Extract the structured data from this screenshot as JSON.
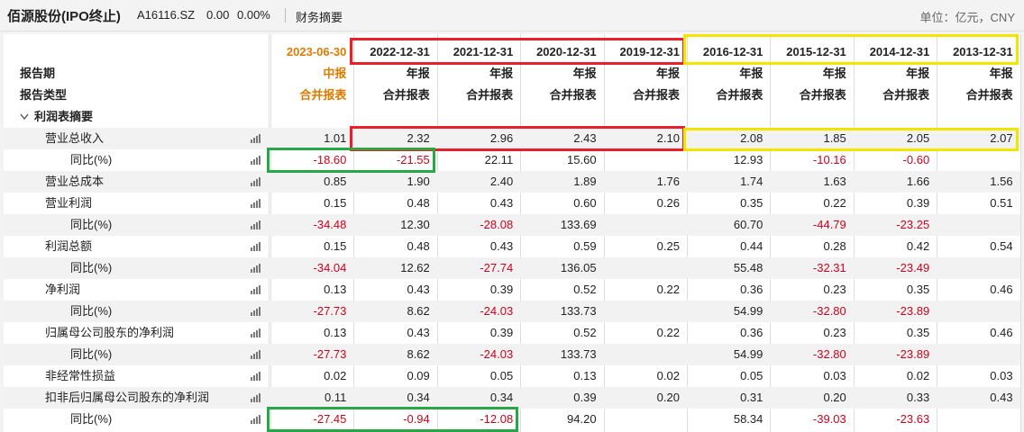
{
  "header": {
    "name": "佰源股份(IPO终止)",
    "code": "A16116.SZ",
    "price": "0.00",
    "change_pct": "0.00%",
    "section": "财务摘要",
    "unit": "单位：亿元，CNY"
  },
  "columns": [
    {
      "date": "2023-06-30",
      "period": "中报",
      "type": "合并报表"
    },
    {
      "date": "2022-12-31",
      "period": "年报",
      "type": "合并报表"
    },
    {
      "date": "2021-12-31",
      "period": "年报",
      "type": "合并报表"
    },
    {
      "date": "2020-12-31",
      "period": "年报",
      "type": "合并报表"
    },
    {
      "date": "2019-12-31",
      "period": "年报",
      "type": "合并报表"
    },
    {
      "date": "2016-12-31",
      "period": "年报",
      "type": "合并报表"
    },
    {
      "date": "2015-12-31",
      "period": "年报",
      "type": "合并报表"
    },
    {
      "date": "2014-12-31",
      "period": "年报",
      "type": "合并报表"
    },
    {
      "date": "2013-12-31",
      "period": "年报",
      "type": "合并报表"
    }
  ],
  "row_labels": {
    "period": "报告期",
    "type": "报告类型",
    "section": "利润表摘要"
  },
  "rows": [
    {
      "label": "营业总收入",
      "indent": 1,
      "chart": true,
      "values": [
        "1.01",
        "2.32",
        "2.96",
        "2.43",
        "2.10",
        "2.08",
        "1.85",
        "2.05",
        "2.07"
      ]
    },
    {
      "label": "同比(%)",
      "indent": 2,
      "chart": true,
      "values": [
        "-18.60",
        "-21.55",
        "22.11",
        "15.60",
        "",
        "12.93",
        "-10.16",
        "-0.60",
        ""
      ]
    },
    {
      "label": "营业总成本",
      "indent": 1,
      "chart": true,
      "values": [
        "0.85",
        "1.90",
        "2.40",
        "1.89",
        "1.76",
        "1.74",
        "1.63",
        "1.66",
        "1.56"
      ]
    },
    {
      "label": "营业利润",
      "indent": 1,
      "chart": true,
      "values": [
        "0.15",
        "0.48",
        "0.43",
        "0.60",
        "0.26",
        "0.35",
        "0.22",
        "0.39",
        "0.51"
      ]
    },
    {
      "label": "同比(%)",
      "indent": 2,
      "chart": true,
      "values": [
        "-34.48",
        "12.30",
        "-28.08",
        "133.69",
        "",
        "60.70",
        "-44.79",
        "-23.25",
        ""
      ]
    },
    {
      "label": "利润总额",
      "indent": 1,
      "chart": true,
      "values": [
        "0.15",
        "0.48",
        "0.43",
        "0.59",
        "0.25",
        "0.44",
        "0.28",
        "0.42",
        "0.54"
      ]
    },
    {
      "label": "同比(%)",
      "indent": 2,
      "chart": true,
      "values": [
        "-34.04",
        "12.62",
        "-27.74",
        "136.05",
        "",
        "55.48",
        "-32.31",
        "-23.49",
        ""
      ]
    },
    {
      "label": "净利润",
      "indent": 1,
      "chart": true,
      "values": [
        "0.13",
        "0.43",
        "0.39",
        "0.52",
        "0.22",
        "0.36",
        "0.23",
        "0.35",
        "0.46"
      ]
    },
    {
      "label": "同比(%)",
      "indent": 2,
      "chart": true,
      "values": [
        "-27.73",
        "8.62",
        "-24.03",
        "133.73",
        "",
        "54.99",
        "-32.80",
        "-23.89",
        ""
      ]
    },
    {
      "label": "归属母公司股东的净利润",
      "indent": 1,
      "chart": true,
      "values": [
        "0.13",
        "0.43",
        "0.39",
        "0.52",
        "0.22",
        "0.36",
        "0.23",
        "0.35",
        "0.46"
      ]
    },
    {
      "label": "同比(%)",
      "indent": 2,
      "chart": true,
      "values": [
        "-27.73",
        "8.62",
        "-24.03",
        "133.73",
        "",
        "54.99",
        "-32.80",
        "-23.89",
        ""
      ]
    },
    {
      "label": "非经常性损益",
      "indent": 1,
      "chart": true,
      "values": [
        "0.02",
        "0.09",
        "0.05",
        "0.13",
        "0.02",
        "0.05",
        "0.03",
        "0.02",
        "0.03"
      ]
    },
    {
      "label": "扣非后归属母公司股东的净利润",
      "indent": 1,
      "chart": true,
      "values": [
        "0.11",
        "0.34",
        "0.34",
        "0.39",
        "0.20",
        "0.31",
        "0.20",
        "0.33",
        "0.43"
      ]
    },
    {
      "label": "同比(%)",
      "indent": 2,
      "chart": true,
      "values": [
        "-27.45",
        "-0.94",
        "-12.08",
        "94.20",
        "",
        "58.34",
        "-39.03",
        "-23.63",
        ""
      ]
    }
  ],
  "colors": {
    "negative": "#d0021b",
    "current_period": "#e07b00",
    "highlight_red": "#e8202a",
    "highlight_yellow": "#f4e500",
    "highlight_green": "#27a745"
  },
  "icons": {
    "collapse": "chevron-down-icon",
    "row_chart": "bar-chart-icon"
  }
}
